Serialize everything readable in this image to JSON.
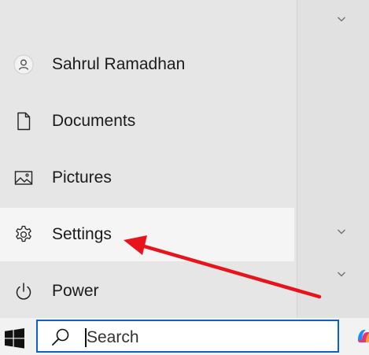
{
  "start_menu": {
    "items": [
      {
        "label": "Sahrul Ramadhan",
        "icon": "user-avatar-icon"
      },
      {
        "label": "Documents",
        "icon": "document-icon"
      },
      {
        "label": "Pictures",
        "icon": "picture-icon"
      },
      {
        "label": "Settings",
        "icon": "gear-icon",
        "highlighted": true
      },
      {
        "label": "Power",
        "icon": "power-icon"
      }
    ]
  },
  "taskbar": {
    "search_placeholder": "Search",
    "icons": [
      "windows-logo-icon",
      "search-icon",
      "copilot-icon"
    ]
  },
  "annotation": {
    "arrow_color": "#e8141c",
    "points_to": "Settings"
  },
  "colors": {
    "accent": "#0a64c8",
    "highlight": "#f5f5f5",
    "menu_bg": "#e6e6e6"
  }
}
